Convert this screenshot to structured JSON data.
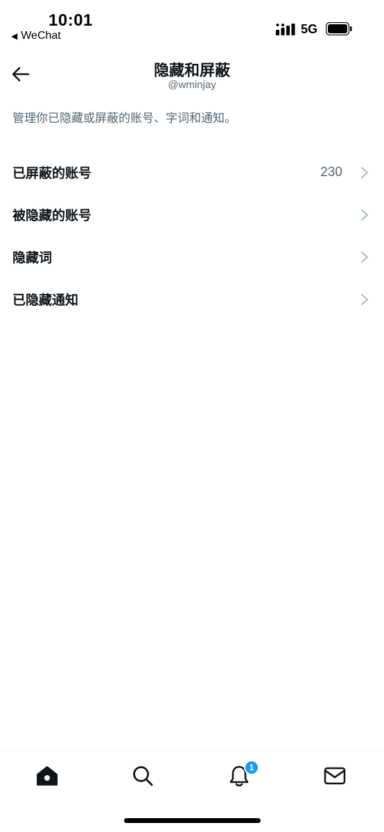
{
  "status_bar": {
    "time": "10:01",
    "back_app": "WeChat",
    "network": "5G"
  },
  "header": {
    "title": "隐藏和屏蔽",
    "subtitle": "@wminjay"
  },
  "description": "管理你已隐藏或屏蔽的账号、字词和通知。",
  "menu": {
    "items": [
      {
        "label": "已屏蔽的账号",
        "count": "230"
      },
      {
        "label": "被隐藏的账号"
      },
      {
        "label": "隐藏词"
      },
      {
        "label": "已隐藏通知"
      }
    ]
  },
  "tabbar": {
    "notification_badge": "1",
    "icons": [
      "home-icon",
      "search-icon",
      "bell-icon",
      "mail-icon"
    ]
  },
  "colors": {
    "text_primary": "#0f1419",
    "text_secondary": "#536471",
    "accent": "#1d9bf0",
    "chevron": "#aab8c2"
  }
}
